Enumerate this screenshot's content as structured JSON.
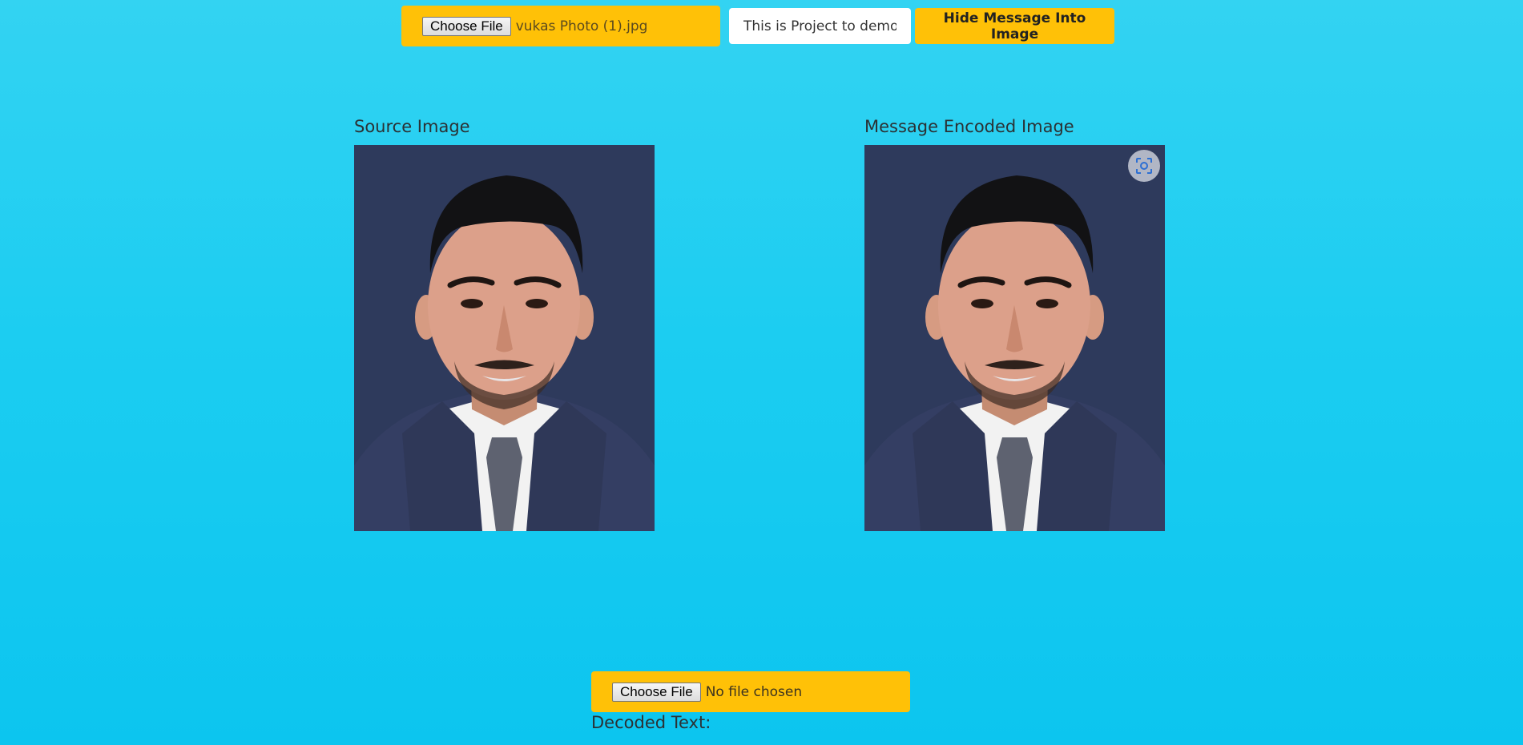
{
  "encode": {
    "choose_file_label": "Choose File",
    "selected_file": "vukas Photo (1).jpg",
    "message_value": "This is Project to demonstrate",
    "hide_button_label": "Hide Message Into Image"
  },
  "images": {
    "source_label": "Source Image",
    "encoded_label": "Message Encoded Image",
    "lens_icon": "visual-search-icon"
  },
  "decode": {
    "choose_file_label": "Choose File",
    "selected_file": "No file chosen",
    "decoded_label": "Decoded Text:",
    "decoded_value": ""
  },
  "colors": {
    "accent": "#ffc107",
    "background": "#1ccdf1",
    "photo_background": "#2e3a5c"
  }
}
